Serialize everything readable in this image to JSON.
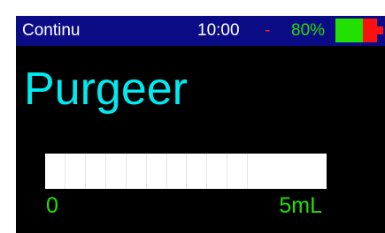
{
  "status": {
    "mode": "Continu",
    "time": "10:00",
    "separator": "-",
    "battery_percent": "80%",
    "battery_level": 0.8,
    "battery_icon": "battery-icon"
  },
  "main": {
    "title": "Purgeer"
  },
  "progress": {
    "min_label": "0",
    "max_label": "5mL",
    "level": 1.0
  },
  "colors": {
    "status_bar_bg": "#0b0b86",
    "title": "#00eaf0",
    "scale": "#22e000",
    "battery_good": "#22e000",
    "battery_low": "#ff1010"
  }
}
